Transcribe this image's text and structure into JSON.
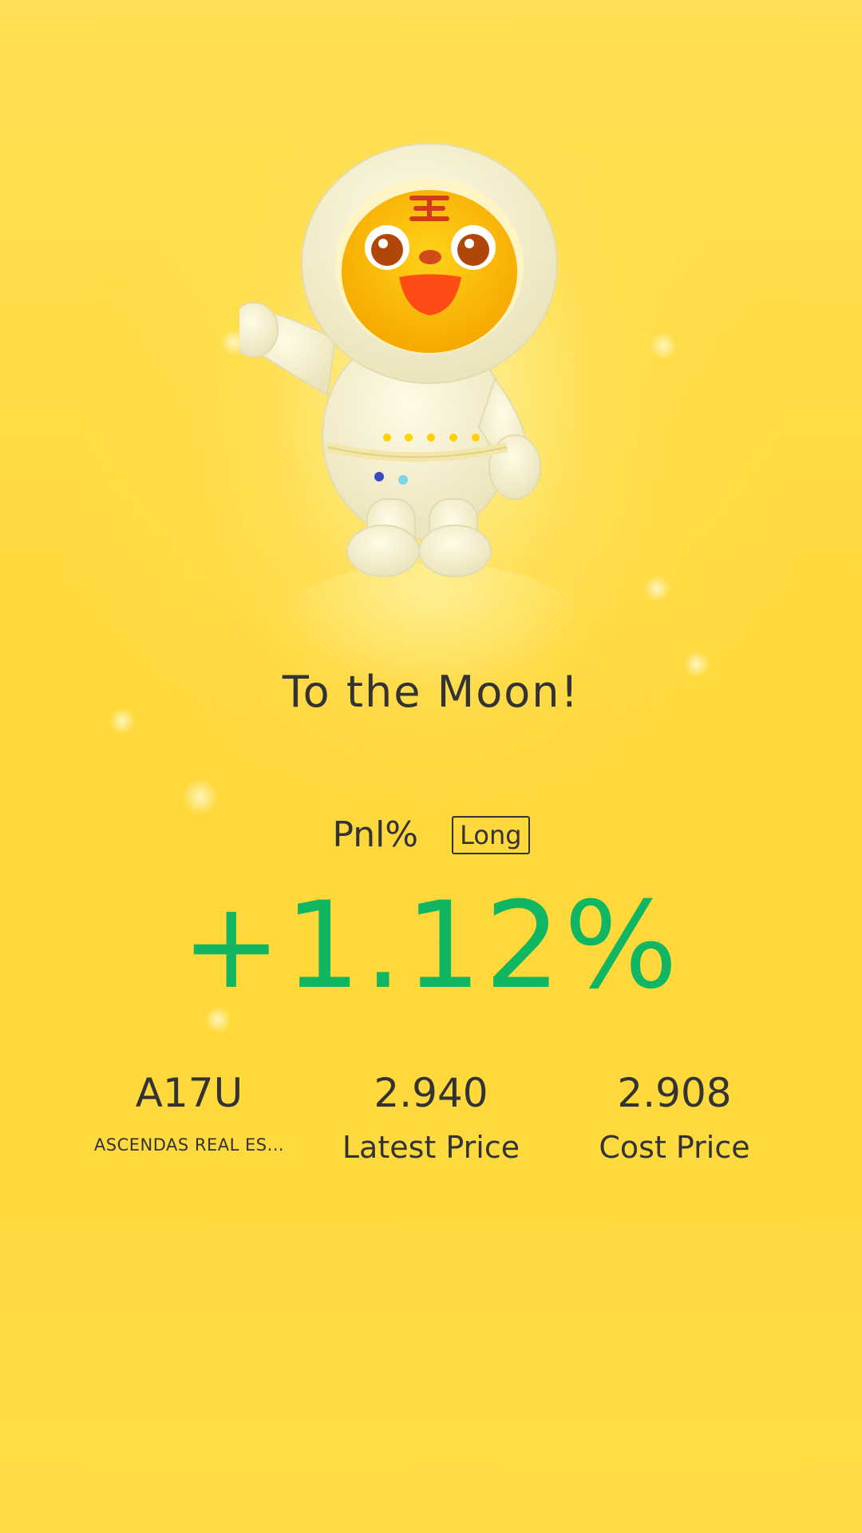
{
  "title": "To the Moon!",
  "pnl": {
    "label": "Pnl%",
    "position_badge": "Long",
    "value": "+1.12%"
  },
  "stats": [
    {
      "value": "A17U",
      "label": "ASCENDAS REAL ES..."
    },
    {
      "value": "2.940",
      "label": "Latest Price"
    },
    {
      "value": "2.908",
      "label": "Cost Price"
    }
  ],
  "colors": {
    "background": "#ffd93b",
    "positive": "#10b662",
    "text": "#333333"
  },
  "icons": {
    "mascot": "tiger-astronaut-mascot-icon"
  }
}
